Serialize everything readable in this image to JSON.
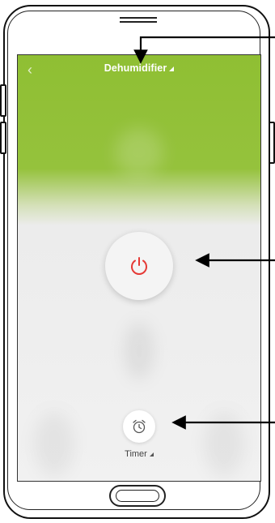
{
  "app": {
    "title": "Dehumidifier",
    "title_caret": "◢"
  },
  "controls": {
    "power_icon": "power-icon",
    "timer_icon": "alarm-clock-icon",
    "timer_label": "Timer",
    "timer_caret": "◢"
  },
  "nav": {
    "back_icon": "chevron-left-icon",
    "back_glyph": "‹"
  },
  "colors": {
    "header_green": "#95c23c",
    "power_red": "#e53935",
    "screen_bg": "#f1f1f1"
  }
}
